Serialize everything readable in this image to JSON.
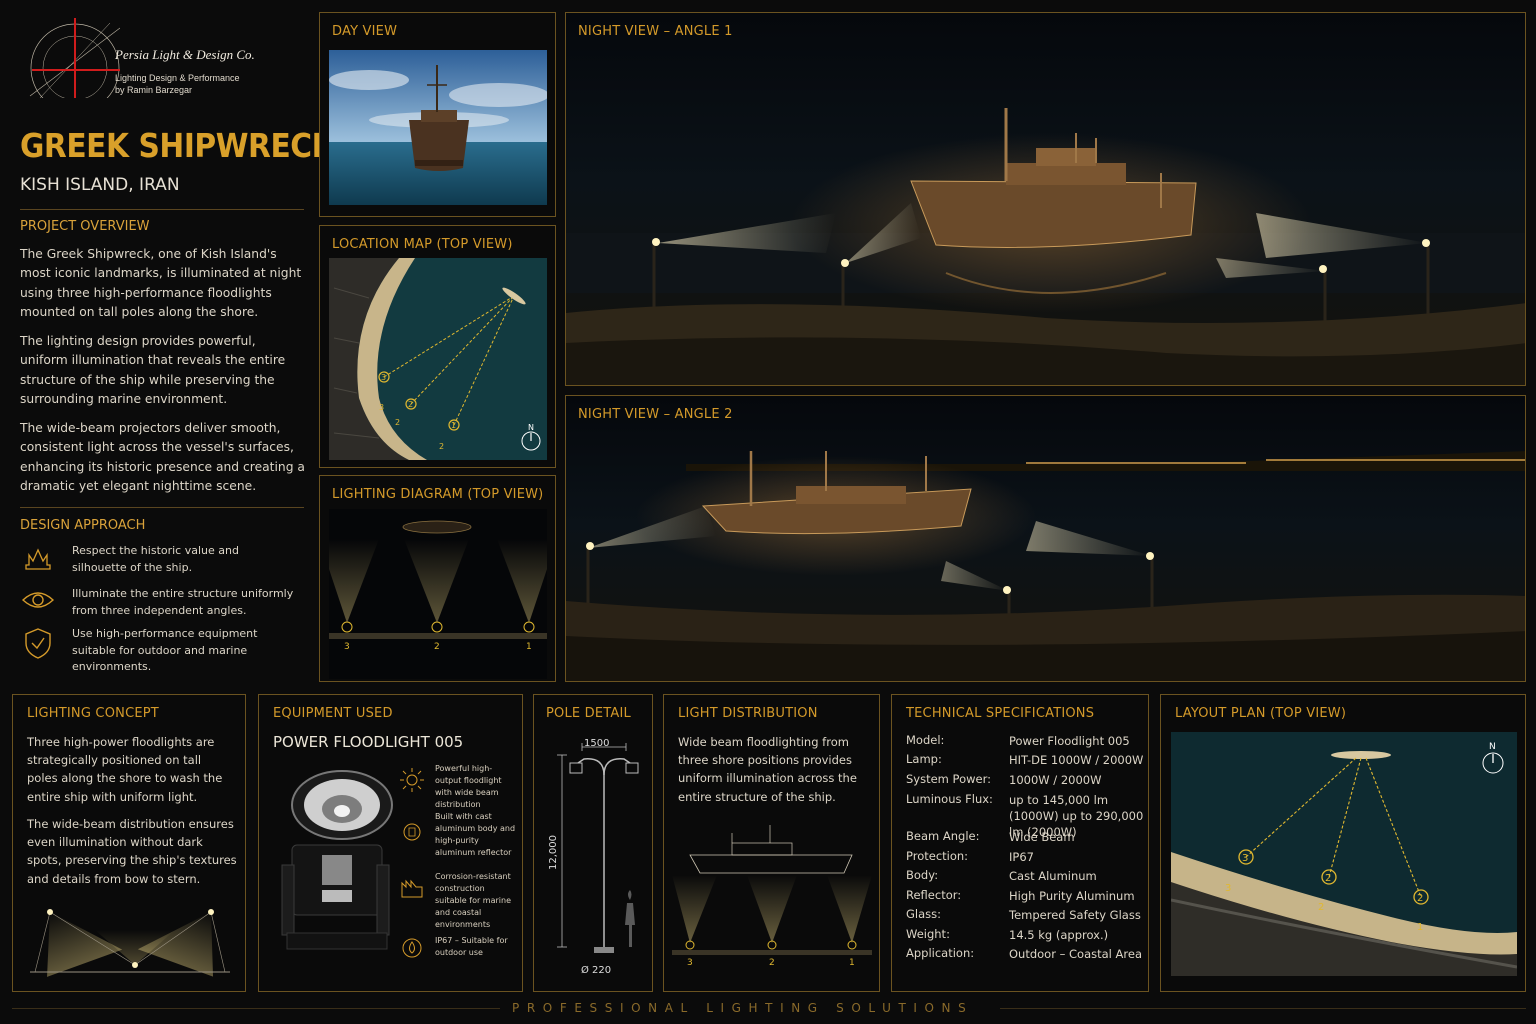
{
  "logo": {
    "company": "Persia Light & Design Co.",
    "line1": "Lighting Design & Performance",
    "line2": "by Ramin Barzegar"
  },
  "project": {
    "title": "GREEK SHIPWRECK",
    "location": "KISH ISLAND, IRAN"
  },
  "overview": {
    "heading": "PROJECT OVERVIEW",
    "p1": "The Greek Shipwreck, one of Kish Island's most iconic landmarks, is illuminated at night using three high-performance floodlights mounted on tall poles along the shore.",
    "p2": "The lighting design provides powerful, uniform illumination that reveals the entire structure of the ship while preserving the surrounding marine environment.",
    "p3": "The wide-beam projectors deliver smooth, consistent light across the vessel's surfaces, enhancing its historic presence and creating a dramatic yet elegant nighttime scene."
  },
  "approach": {
    "heading": "DESIGN APPROACH",
    "items": [
      {
        "icon": "crown-icon",
        "text": "Respect the historic value and silhouette of the ship."
      },
      {
        "icon": "eye-icon",
        "text": "Illuminate the entire structure uniformly from three independent angles."
      },
      {
        "icon": "shield-check-icon",
        "text": "Use high-performance equipment suitable for outdoor and marine environments."
      }
    ]
  },
  "panels": {
    "day_view": "DAY VIEW",
    "location_map": "LOCATION MAP (TOP VIEW)",
    "lighting_diagram": "LIGHTING DIAGRAM (TOP VIEW)",
    "night1": "NIGHT VIEW – ANGLE 1",
    "night2": "NIGHT VIEW – ANGLE 2"
  },
  "map_labels": {
    "north": "N",
    "n1": "1",
    "n2": "2",
    "n3": "3"
  },
  "concept": {
    "heading": "LIGHTING CONCEPT",
    "p1": "Three high-power floodlights are strategically positioned on tall poles along the shore to wash the entire ship with uniform light.",
    "p2": "The wide-beam distribution ensures even illumination without dark spots, preserving the ship's textures and details from bow to stern."
  },
  "equipment": {
    "heading": "EQUIPMENT USED",
    "model": "POWER FLOODLIGHT 005",
    "features": [
      {
        "icon": "sun-icon",
        "text": "Powerful high-output floodlight with wide beam distribution"
      },
      {
        "icon": "shield-icon",
        "text": "Built with cast aluminum body and high-purity aluminum reflector"
      },
      {
        "icon": "factory-icon",
        "text": "Corrosion-resistant construction suitable for marine and coastal environments"
      },
      {
        "icon": "droplet-icon",
        "text": "IP67 – Suitable for outdoor use"
      }
    ]
  },
  "pole": {
    "heading": "POLE DETAIL",
    "width": "1500",
    "height": "12,000",
    "base": "Ø 220"
  },
  "distribution": {
    "heading": "LIGHT DISTRIBUTION",
    "text": "Wide beam floodlighting from three shore positions provides uniform illumination across the entire structure of the ship."
  },
  "specs": {
    "heading": "TECHNICAL SPECIFICATIONS",
    "rows": [
      {
        "k": "Model:",
        "v": "Power Floodlight 005"
      },
      {
        "k": "Lamp:",
        "v": "HIT-DE 1000W / 2000W"
      },
      {
        "k": "System Power:",
        "v": "1000W / 2000W"
      },
      {
        "k": "Luminous Flux:",
        "v": "up to 145,000 lm (1000W) up to 290,000 lm (2000W)"
      },
      {
        "k": "Beam Angle:",
        "v": "Wide Beam"
      },
      {
        "k": "Protection:",
        "v": "IP67"
      },
      {
        "k": "Body:",
        "v": "Cast Aluminum"
      },
      {
        "k": "Reflector:",
        "v": "High Purity Aluminum"
      },
      {
        "k": "Glass:",
        "v": "Tempered Safety Glass"
      },
      {
        "k": "Weight:",
        "v": "14.5 kg (approx.)"
      },
      {
        "k": "Application:",
        "v": "Outdoor – Coastal Area"
      }
    ]
  },
  "layout_plan": {
    "heading": "LAYOUT PLAN (TOP VIEW)"
  },
  "footer": "PROFESSIONAL LIGHTING SOLUTIONS",
  "colors": {
    "accent": "#d49a2a",
    "border": "#6b5320",
    "background": "#0b0b0b"
  }
}
